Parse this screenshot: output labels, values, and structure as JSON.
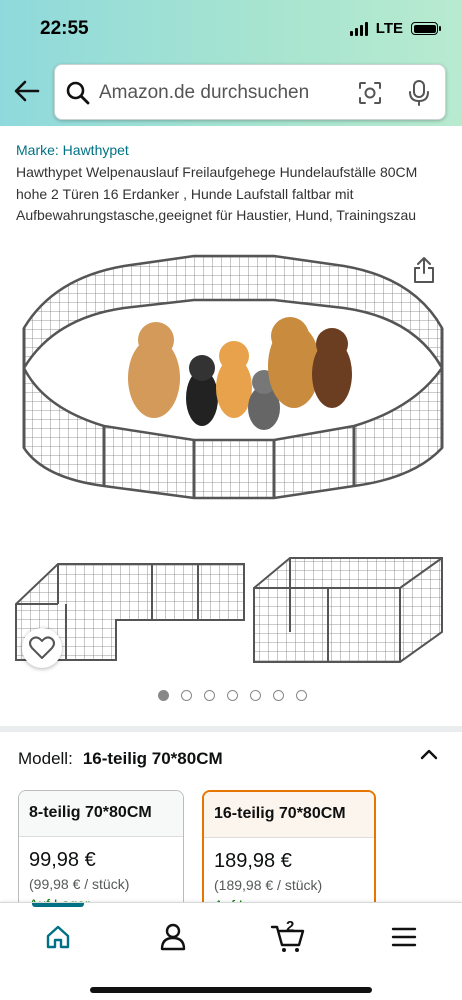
{
  "status_bar": {
    "time": "22:55",
    "network": "LTE",
    "signal_bars": 4,
    "battery_level": 1.0
  },
  "search": {
    "placeholder": "Amazon.de durchsuchen"
  },
  "product": {
    "brand": "Marke: Hawthypet",
    "title": "Hawthypet Welpenauslauf Freilaufgehege Hundelaufställe 80CM hohe 2 Türen 16 Erdanker , Hunde Laufstall faltbar mit Aufbewahrungstasche,geeignet für Haustier, Hund, Trainingszau"
  },
  "gallery": {
    "image_count": 7,
    "active_index": 0
  },
  "variants": {
    "label": "Modell:",
    "selected_value": "16-teilig 70*80CM",
    "options": [
      {
        "name": "8-teilig 70*80CM",
        "price": "99,98 €",
        "unit_price": "(99,98 € / stück)",
        "stock": "Auf Lager",
        "selected": false
      },
      {
        "name": "16-teilig 70*80CM",
        "price": "189,98 €",
        "unit_price": "(189,98 € / stück)",
        "stock": "Auf Lager",
        "selected": true
      }
    ]
  },
  "bottom_nav": {
    "cart_count": "2"
  },
  "colors": {
    "link": "#007185",
    "accent": "#e77600",
    "header_gradient_start": "#8fd9dc",
    "header_gradient_end": "#b8ead0"
  }
}
